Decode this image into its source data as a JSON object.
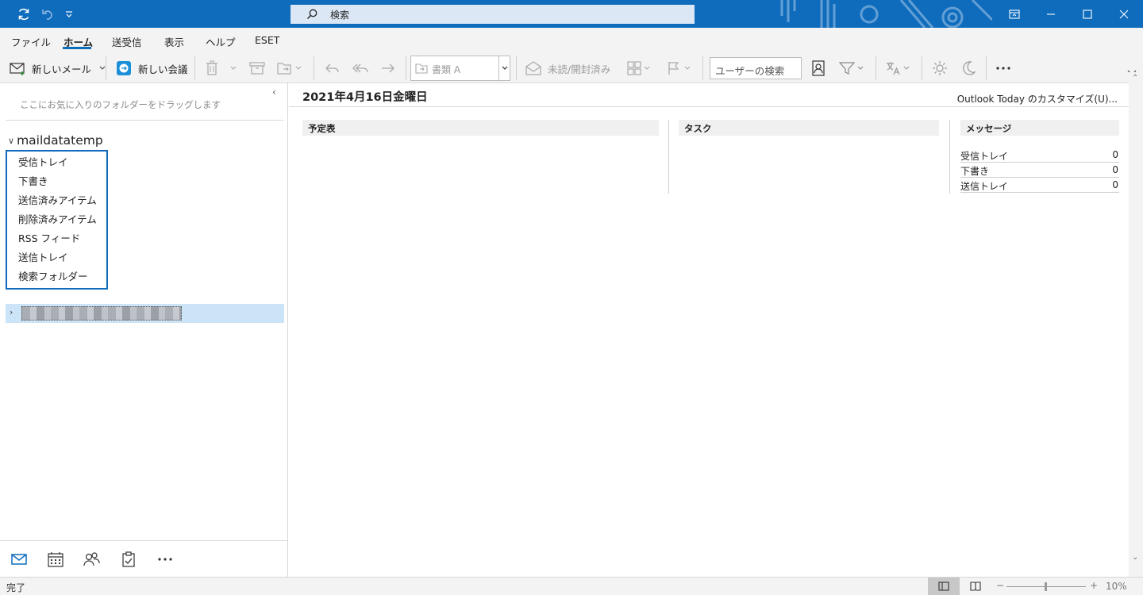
{
  "titlebar": {
    "search_label": "検索",
    "icons": [
      "sync-icon",
      "undo-icon",
      "qat-dropdown-icon",
      "search-icon",
      "ribbon-display-icon",
      "minimize-icon",
      "maximize-icon",
      "close-icon"
    ]
  },
  "menu": {
    "items": [
      "ファイル",
      "ホーム",
      "送受信",
      "表示",
      "ヘルプ",
      "ESET"
    ],
    "active": "ホーム"
  },
  "ribbon": {
    "new_mail": "新しいメール",
    "new_meeting": "新しい会議",
    "category_combo": "書類 A",
    "unread_read": "未読/開封済み",
    "user_search": "ユーザーの検索"
  },
  "folder_pane": {
    "favorites_hint": "ここにお気に入りのフォルダーをドラッグします",
    "account_name": "maildatatemp",
    "folders": [
      "受信トレイ",
      "下書き",
      "送信済みアイテム",
      "削除済みアイテム",
      "RSS フィード",
      "送信トレイ",
      "検索フォルダー"
    ]
  },
  "reading": {
    "date_title": "2021年4月16日金曜日",
    "customize_link": "Outlook Today のカスタマイズ(U)...",
    "columns": [
      "予定表",
      "タスク",
      "メッセージ"
    ],
    "messages": [
      {
        "label": "受信トレイ",
        "count": "0"
      },
      {
        "label": "下書き",
        "count": "0"
      },
      {
        "label": "送信トレイ",
        "count": "0"
      }
    ]
  },
  "statusbar": {
    "status": "完了",
    "zoom": "10%",
    "zoom_minus": "−",
    "zoom_plus": "+"
  },
  "colors": {
    "accent": "#0f6cbd",
    "selected_row": "#cce4f7"
  }
}
